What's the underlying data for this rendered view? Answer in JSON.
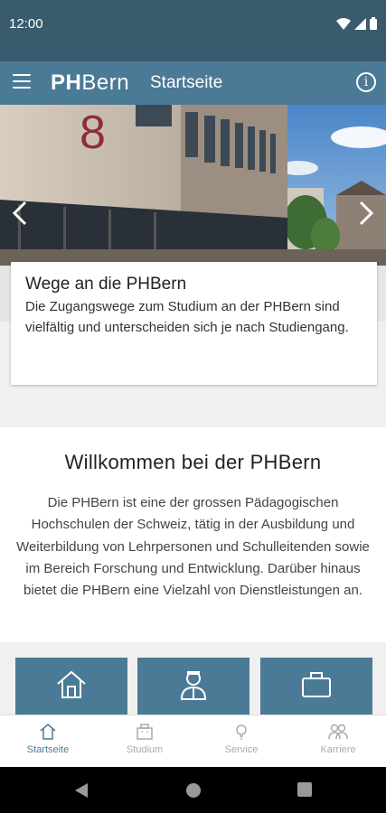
{
  "status_bar": {
    "time": "12:00"
  },
  "app_bar": {
    "logo_ph": "PH",
    "logo_bern": "Bern",
    "title": "Startseite"
  },
  "hero": {
    "building_number": "8"
  },
  "card": {
    "title": "Wege an die PHBern",
    "text": "Die Zugangswege zum Studium an der PHBern sind vielfältig und unterscheiden sich je nach Studiengang."
  },
  "welcome": {
    "title": "Willkommen bei der PHBern",
    "text": "Die PHBern ist eine der grossen Pädagogischen Hochschulen der Schweiz, tätig in der Ausbildung und Weiterbildung von Lehrpersonen und Schulleitenden sowie im Bereich Forschung und Entwicklung. Darüber hinaus bietet die PHBern eine Vielzahl von Dienstleistungen an."
  },
  "tiles": [
    {
      "icon": "house-icon"
    },
    {
      "icon": "person-icon"
    },
    {
      "icon": "briefcase-icon"
    }
  ],
  "bottom_nav": {
    "items": [
      {
        "label": "Startseite",
        "icon": "home-icon",
        "active": true
      },
      {
        "label": "Studium",
        "icon": "building-icon",
        "active": false
      },
      {
        "label": "Service",
        "icon": "lightbulb-icon",
        "active": false
      },
      {
        "label": "Karriere",
        "icon": "people-icon",
        "active": false
      }
    ]
  },
  "colors": {
    "primary": "#4b7a96",
    "status_bar": "#3a5b6d",
    "inactive": "#aaaaaa"
  }
}
